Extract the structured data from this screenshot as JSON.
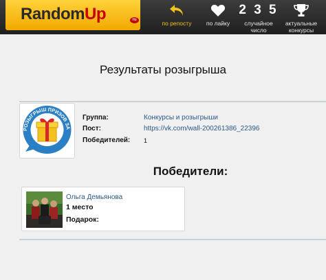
{
  "header": {
    "logo_main": "Random",
    "logo_accent": "Up",
    "logo_tld": "ru",
    "nav": [
      {
        "label": "по репосту"
      },
      {
        "label": "по лайку"
      },
      {
        "number": "2 3 5",
        "label": "случайное число"
      },
      {
        "label": "актуальные конкурсы"
      }
    ]
  },
  "page": {
    "title": "Результаты розыгрыша"
  },
  "giveaway": {
    "avatar_text": "РОЗЫГРЫШ ПРИЗОВ ЗА РЕПОСТ",
    "rows": [
      {
        "key": "Группа:",
        "value": "Конкурсы и розыгрыши"
      },
      {
        "key": "Пост:",
        "value": "https://vk.com/wall-200261386_22396"
      },
      {
        "key": "Победителей:",
        "value": "1"
      }
    ]
  },
  "winners": {
    "title": "Победители:",
    "items": [
      {
        "name": "Ольга Демьянова",
        "place": "1 место",
        "prize": "Подарок:"
      }
    ]
  },
  "colors": {
    "header_bg": "#2b2b2b",
    "logo_bg": "#f7b800",
    "accent_yellow": "#f2c21a",
    "link": "#2a5885",
    "logo_red": "#c80000"
  }
}
